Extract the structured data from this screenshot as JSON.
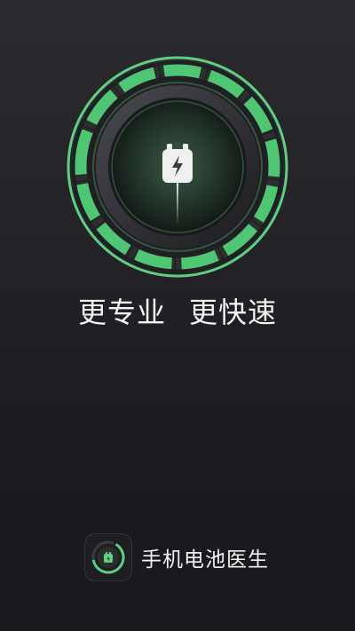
{
  "splash": {
    "slogan_part1": "更专业",
    "slogan_part2": "更快速",
    "app_name": "手机电池医生",
    "icons": {
      "gauge": "battery-gauge-icon",
      "battery": "charging-battery-icon",
      "app": "app-logo-icon"
    },
    "colors": {
      "accent": "#5fd083",
      "background": "#232327",
      "text": "#f4f4f4"
    }
  }
}
